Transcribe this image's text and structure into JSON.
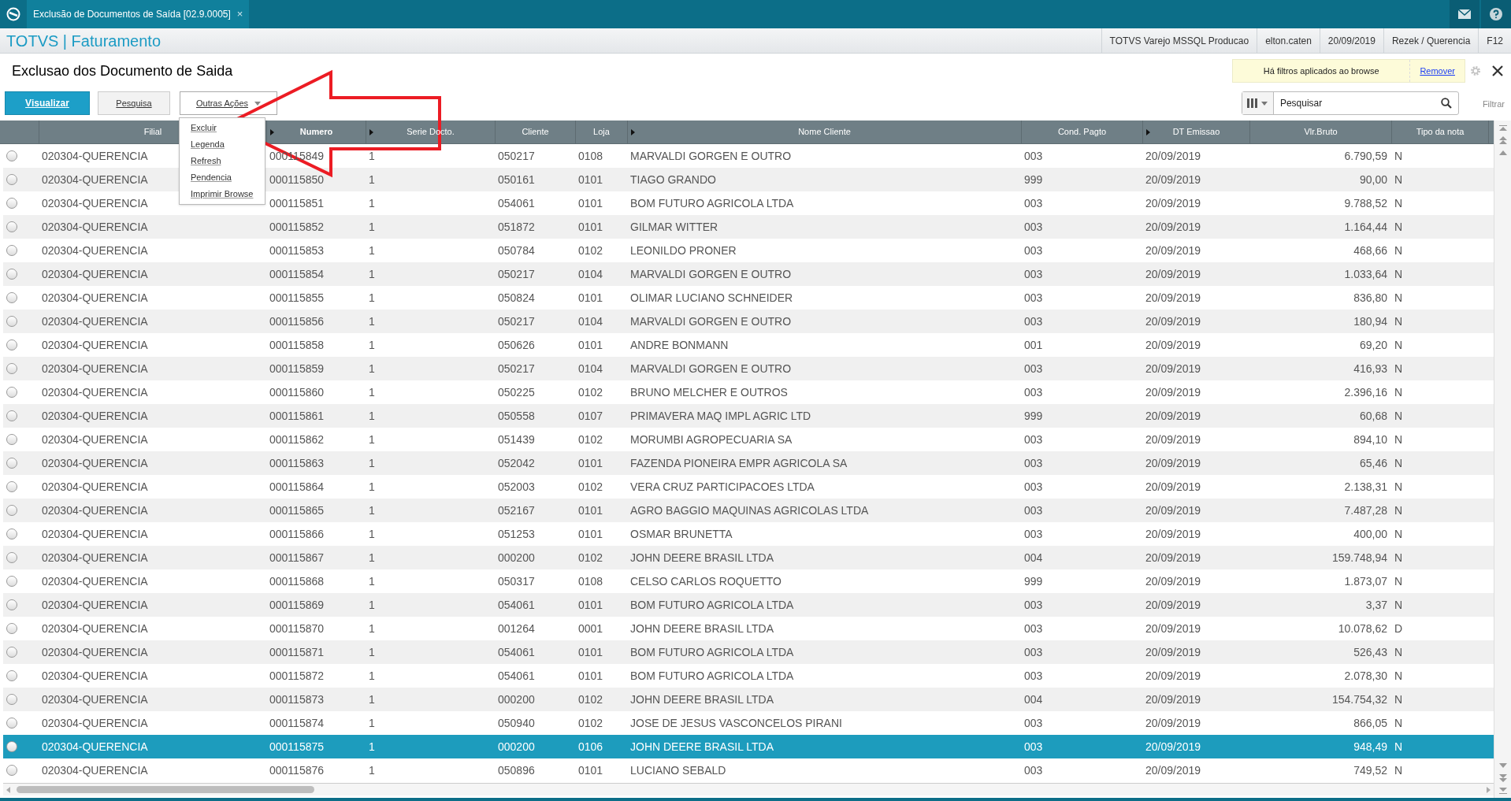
{
  "app_tab": {
    "title": "Exclusão de Documentos de Saída [02.9.0005]",
    "close": "×"
  },
  "header": {
    "title": "TOTVS | Faturamento",
    "info": [
      "TOTVS Varejo MSSQL Producao",
      "elton.caten",
      "20/09/2019",
      "Rezek / Querencia",
      "F12"
    ]
  },
  "page_title": "Exclusao dos Documento de Saida",
  "filter_notice": {
    "text": "Há filtros aplicados ao browse",
    "link": "Remover"
  },
  "buttons": [
    {
      "label": "Visualizar",
      "primary": true
    },
    {
      "label": "Pesquisa",
      "primary": false
    }
  ],
  "more_actions": {
    "label": "Outras Ações",
    "expanded": true,
    "items": [
      "Excluir",
      "Legenda",
      "Refresh",
      "Pendencia",
      "Imprimir Browse"
    ]
  },
  "search": {
    "placeholder": "Pesquisar"
  },
  "filter_label": "Filtrar",
  "table": {
    "columns": [
      {
        "label": "Filial",
        "sort_marker": false,
        "bold": false,
        "kind": "text"
      },
      {
        "label": "Numero",
        "sort_marker": true,
        "bold": true,
        "kind": "text"
      },
      {
        "label": "Serie Docto.",
        "sort_marker": true,
        "bold": false,
        "kind": "text"
      },
      {
        "label": "Cliente",
        "sort_marker": false,
        "bold": false,
        "kind": "text"
      },
      {
        "label": "Loja",
        "sort_marker": false,
        "bold": false,
        "kind": "text"
      },
      {
        "label": "Nome Cliente",
        "sort_marker": true,
        "bold": false,
        "kind": "text"
      },
      {
        "label": "Cond. Pagto",
        "sort_marker": false,
        "bold": false,
        "kind": "text"
      },
      {
        "label": "DT Emissao",
        "sort_marker": true,
        "bold": false,
        "kind": "text"
      },
      {
        "label": "Vlr.Bruto",
        "sort_marker": false,
        "bold": false,
        "kind": "money"
      },
      {
        "label": "Tipo da nota",
        "sort_marker": false,
        "bold": false,
        "kind": "text"
      }
    ],
    "rows": [
      {
        "selected": false,
        "cells": [
          "020304-QUERENCIA",
          "000115849",
          "1",
          "050217",
          "0108",
          "MARVALDI GORGEN E OUTRO",
          "003",
          "20/09/2019",
          "6.790,59",
          "N"
        ]
      },
      {
        "selected": false,
        "cells": [
          "020304-QUERENCIA",
          "000115850",
          "1",
          "050161",
          "0101",
          "TIAGO GRANDO",
          "999",
          "20/09/2019",
          "90,00",
          "N"
        ]
      },
      {
        "selected": false,
        "cells": [
          "020304-QUERENCIA",
          "000115851",
          "1",
          "054061",
          "0101",
          "BOM FUTURO AGRICOLA LTDA",
          "003",
          "20/09/2019",
          "9.788,52",
          "N"
        ]
      },
      {
        "selected": false,
        "cells": [
          "020304-QUERENCIA",
          "000115852",
          "1",
          "051872",
          "0101",
          "GILMAR WITTER",
          "003",
          "20/09/2019",
          "1.164,44",
          "N"
        ]
      },
      {
        "selected": false,
        "cells": [
          "020304-QUERENCIA",
          "000115853",
          "1",
          "050784",
          "0102",
          "LEONILDO PRONER",
          "003",
          "20/09/2019",
          "468,66",
          "N"
        ]
      },
      {
        "selected": false,
        "cells": [
          "020304-QUERENCIA",
          "000115854",
          "1",
          "050217",
          "0104",
          "MARVALDI GORGEN E OUTRO",
          "003",
          "20/09/2019",
          "1.033,64",
          "N"
        ]
      },
      {
        "selected": false,
        "cells": [
          "020304-QUERENCIA",
          "000115855",
          "1",
          "050824",
          "0101",
          "OLIMAR LUCIANO SCHNEIDER",
          "003",
          "20/09/2019",
          "836,80",
          "N"
        ]
      },
      {
        "selected": false,
        "cells": [
          "020304-QUERENCIA",
          "000115856",
          "1",
          "050217",
          "0104",
          "MARVALDI GORGEN E OUTRO",
          "003",
          "20/09/2019",
          "180,94",
          "N"
        ]
      },
      {
        "selected": false,
        "cells": [
          "020304-QUERENCIA",
          "000115858",
          "1",
          "050626",
          "0101",
          "ANDRE BONMANN",
          "001",
          "20/09/2019",
          "69,20",
          "N"
        ]
      },
      {
        "selected": false,
        "cells": [
          "020304-QUERENCIA",
          "000115859",
          "1",
          "050217",
          "0104",
          "MARVALDI GORGEN E OUTRO",
          "003",
          "20/09/2019",
          "416,93",
          "N"
        ]
      },
      {
        "selected": false,
        "cells": [
          "020304-QUERENCIA",
          "000115860",
          "1",
          "050225",
          "0102",
          "BRUNO MELCHER E OUTROS",
          "003",
          "20/09/2019",
          "2.396,16",
          "N"
        ]
      },
      {
        "selected": false,
        "cells": [
          "020304-QUERENCIA",
          "000115861",
          "1",
          "050558",
          "0107",
          "PRIMAVERA MAQ IMPL AGRIC LTD",
          "999",
          "20/09/2019",
          "60,68",
          "N"
        ]
      },
      {
        "selected": false,
        "cells": [
          "020304-QUERENCIA",
          "000115862",
          "1",
          "051439",
          "0102",
          "MORUMBI AGROPECUARIA SA",
          "003",
          "20/09/2019",
          "894,10",
          "N"
        ]
      },
      {
        "selected": false,
        "cells": [
          "020304-QUERENCIA",
          "000115863",
          "1",
          "052042",
          "0101",
          "FAZENDA PIONEIRA EMPR AGRICOLA SA",
          "003",
          "20/09/2019",
          "65,46",
          "N"
        ]
      },
      {
        "selected": false,
        "cells": [
          "020304-QUERENCIA",
          "000115864",
          "1",
          "052003",
          "0102",
          "VERA CRUZ PARTICIPACOES LTDA",
          "003",
          "20/09/2019",
          "2.138,31",
          "N"
        ]
      },
      {
        "selected": false,
        "cells": [
          "020304-QUERENCIA",
          "000115865",
          "1",
          "052167",
          "0101",
          "AGRO BAGGIO MAQUINAS AGRICOLAS LTDA",
          "003",
          "20/09/2019",
          "7.487,28",
          "N"
        ]
      },
      {
        "selected": false,
        "cells": [
          "020304-QUERENCIA",
          "000115866",
          "1",
          "051253",
          "0101",
          "OSMAR BRUNETTA",
          "003",
          "20/09/2019",
          "400,00",
          "N"
        ]
      },
      {
        "selected": false,
        "cells": [
          "020304-QUERENCIA",
          "000115867",
          "1",
          "000200",
          "0102",
          "JOHN DEERE BRASIL LTDA",
          "004",
          "20/09/2019",
          "159.748,94",
          "N"
        ]
      },
      {
        "selected": false,
        "cells": [
          "020304-QUERENCIA",
          "000115868",
          "1",
          "050317",
          "0108",
          "CELSO CARLOS ROQUETTO",
          "999",
          "20/09/2019",
          "1.873,07",
          "N"
        ]
      },
      {
        "selected": false,
        "cells": [
          "020304-QUERENCIA",
          "000115869",
          "1",
          "054061",
          "0101",
          "BOM FUTURO AGRICOLA LTDA",
          "003",
          "20/09/2019",
          "3,37",
          "N"
        ]
      },
      {
        "selected": false,
        "cells": [
          "020304-QUERENCIA",
          "000115870",
          "1",
          "001264",
          "0001",
          "JOHN DEERE BRASIL LTDA",
          "003",
          "20/09/2019",
          "10.078,62",
          "D"
        ]
      },
      {
        "selected": false,
        "cells": [
          "020304-QUERENCIA",
          "000115871",
          "1",
          "054061",
          "0101",
          "BOM FUTURO AGRICOLA LTDA",
          "003",
          "20/09/2019",
          "526,43",
          "N"
        ]
      },
      {
        "selected": false,
        "cells": [
          "020304-QUERENCIA",
          "000115872",
          "1",
          "054061",
          "0101",
          "BOM FUTURO AGRICOLA LTDA",
          "003",
          "20/09/2019",
          "2.078,30",
          "N"
        ]
      },
      {
        "selected": false,
        "cells": [
          "020304-QUERENCIA",
          "000115873",
          "1",
          "000200",
          "0102",
          "JOHN DEERE BRASIL LTDA",
          "004",
          "20/09/2019",
          "154.754,32",
          "N"
        ]
      },
      {
        "selected": false,
        "cells": [
          "020304-QUERENCIA",
          "000115874",
          "1",
          "050940",
          "0102",
          "JOSE DE JESUS VASCONCELOS PIRANI",
          "003",
          "20/09/2019",
          "866,05",
          "N"
        ]
      },
      {
        "selected": true,
        "cells": [
          "020304-QUERENCIA",
          "000115875",
          "1",
          "000200",
          "0106",
          "JOHN DEERE BRASIL LTDA",
          "003",
          "20/09/2019",
          "948,49",
          "N"
        ]
      },
      {
        "selected": false,
        "cells": [
          "020304-QUERENCIA",
          "000115876",
          "1",
          "050896",
          "0101",
          "LUCIANO SEBALD",
          "003",
          "20/09/2019",
          "749,52",
          "N"
        ]
      }
    ]
  }
}
